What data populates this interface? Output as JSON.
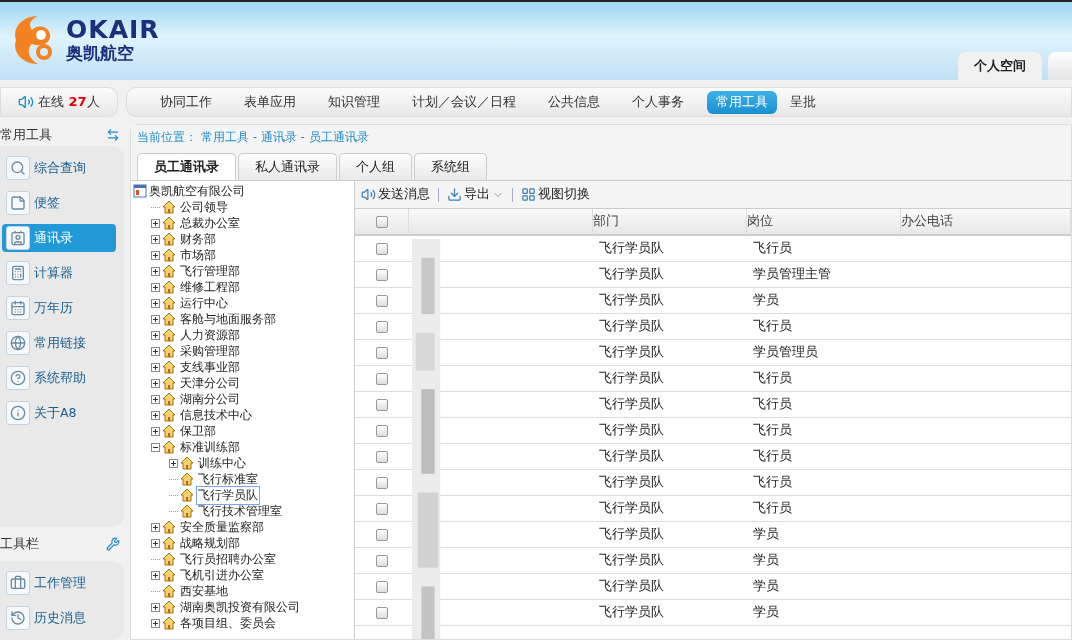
{
  "header": {
    "logo_latin": "OKAIR",
    "logo_chinese": "奥凯航空",
    "tabs": [
      {
        "label": "个人空间",
        "selected": true
      }
    ]
  },
  "online": {
    "label": "在线",
    "count": "27",
    "unit": "人"
  },
  "nav": [
    {
      "label": "协同工作",
      "selected": false
    },
    {
      "label": "表单应用",
      "selected": false
    },
    {
      "label": "知识管理",
      "selected": false
    },
    {
      "label": "计划／会议／日程",
      "selected": false
    },
    {
      "label": "公共信息",
      "selected": false
    },
    {
      "label": "个人事务",
      "selected": false
    },
    {
      "label": "常用工具",
      "selected": true
    },
    {
      "label": "呈批",
      "selected": false
    }
  ],
  "sidebar": {
    "title": "常用工具",
    "items": [
      {
        "label": "综合查询",
        "kind": "search",
        "selected": false
      },
      {
        "label": "便签",
        "kind": "note",
        "selected": false
      },
      {
        "label": "通讯录",
        "kind": "contacts",
        "selected": true
      },
      {
        "label": "计算器",
        "kind": "calculator",
        "selected": false
      },
      {
        "label": "万年历",
        "kind": "calendar",
        "selected": false
      },
      {
        "label": "常用链接",
        "kind": "link",
        "selected": false
      },
      {
        "label": "系统帮助",
        "kind": "help",
        "selected": false
      },
      {
        "label": "关于A8",
        "kind": "about",
        "selected": false
      }
    ],
    "toolbar_title": "工具栏",
    "tool_items": [
      {
        "label": "工作管理",
        "kind": "work",
        "selected": false
      },
      {
        "label": "历史消息",
        "kind": "history",
        "selected": false
      }
    ]
  },
  "breadcrumb": "当前位置： 常用工具 - 通讯录 - 员工通讯录",
  "tabs": [
    {
      "label": "员工通讯录",
      "selected": true
    },
    {
      "label": "私人通讯录",
      "selected": false
    },
    {
      "label": "个人组",
      "selected": false
    },
    {
      "label": "系统组",
      "selected": false
    }
  ],
  "tree": {
    "label": "奥凯航空有限公司",
    "children": [
      {
        "label": "公司领导",
        "selected": false
      },
      {
        "label": "总裁办公室",
        "expanded": false,
        "selected": false
      },
      {
        "label": "财务部",
        "expanded": false,
        "selected": false
      },
      {
        "label": "市场部",
        "expanded": false,
        "selected": false
      },
      {
        "label": "飞行管理部",
        "expanded": false,
        "selected": false
      },
      {
        "label": "维修工程部",
        "expanded": false,
        "selected": false
      },
      {
        "label": "运行中心",
        "expanded": false,
        "selected": false
      },
      {
        "label": "客舱与地面服务部",
        "expanded": false,
        "selected": false
      },
      {
        "label": "人力资源部",
        "expanded": false,
        "selected": false
      },
      {
        "label": "采购管理部",
        "expanded": false,
        "selected": false
      },
      {
        "label": "支线事业部",
        "expanded": false,
        "selected": false
      },
      {
        "label": "天津分公司",
        "expanded": false,
        "selected": false
      },
      {
        "label": "湖南分公司",
        "expanded": false,
        "selected": false
      },
      {
        "label": "信息技术中心",
        "expanded": false,
        "selected": false
      },
      {
        "label": "保卫部",
        "expanded": false,
        "selected": false
      },
      {
        "label": "标准训练部",
        "expanded": true,
        "selected": false,
        "children": [
          {
            "label": "训练中心",
            "expanded": false,
            "selected": false
          },
          {
            "label": "飞行标准室",
            "selected": false
          },
          {
            "label": "飞行学员队",
            "selected": true
          },
          {
            "label": "飞行技术管理室",
            "selected": false
          }
        ]
      },
      {
        "label": "安全质量监察部",
        "expanded": false,
        "selected": false
      },
      {
        "label": "战略规划部",
        "expanded": false,
        "selected": false
      },
      {
        "label": "飞行员招聘办公室",
        "selected": false
      },
      {
        "label": "飞机引进办公室",
        "expanded": false,
        "selected": false
      },
      {
        "label": "西安基地",
        "selected": false
      },
      {
        "label": "湖南奥凯投资有限公司",
        "expanded": false,
        "selected": false
      },
      {
        "label": "各项目组、委员会",
        "expanded": false,
        "selected": false
      }
    ]
  },
  "actions": [
    {
      "label": "发送消息",
      "kind": "send"
    },
    {
      "label": "导出",
      "kind": "export"
    },
    {
      "label": "视图切换",
      "kind": "view"
    }
  ],
  "table": {
    "header_checked": false,
    "columns": [
      "部门",
      "岗位",
      "办公电话"
    ],
    "rows": [
      {
        "checked": false,
        "dept": "飞行学员队",
        "post": "飞行员"
      },
      {
        "checked": false,
        "dept": "飞行学员队",
        "post": "学员管理主管"
      },
      {
        "checked": false,
        "dept": "飞行学员队",
        "post": "学员"
      },
      {
        "checked": false,
        "dept": "飞行学员队",
        "post": "飞行员"
      },
      {
        "checked": false,
        "dept": "飞行学员队",
        "post": "学员管理员"
      },
      {
        "checked": false,
        "dept": "飞行学员队",
        "post": "飞行员"
      },
      {
        "checked": false,
        "dept": "飞行学员队",
        "post": "飞行员"
      },
      {
        "checked": false,
        "dept": "飞行学员队",
        "post": "飞行员"
      },
      {
        "checked": false,
        "dept": "飞行学员队",
        "post": "飞行员"
      },
      {
        "checked": false,
        "dept": "飞行学员队",
        "post": "飞行员"
      },
      {
        "checked": false,
        "dept": "飞行学员队",
        "post": "飞行员"
      },
      {
        "checked": false,
        "dept": "飞行学员队",
        "post": "学员"
      },
      {
        "checked": false,
        "dept": "飞行学员队",
        "post": "学员"
      },
      {
        "checked": false,
        "dept": "飞行学员队",
        "post": "学员"
      },
      {
        "checked": false,
        "dept": "飞行学员队",
        "post": "学员"
      }
    ]
  }
}
